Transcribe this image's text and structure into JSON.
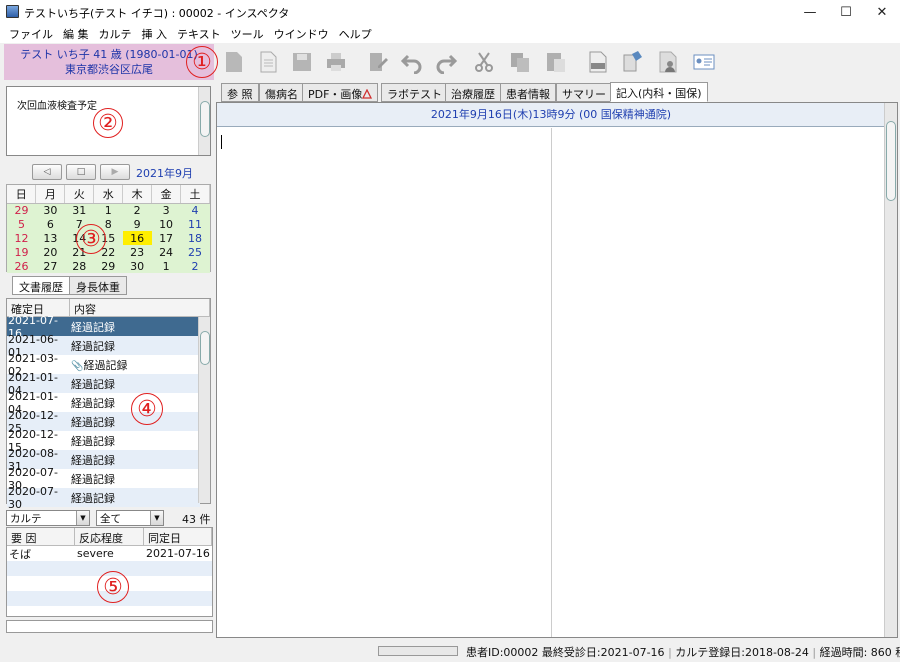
{
  "window": {
    "title": "テストいち子(テスト イチコ) : 00002 - インスペクタ"
  },
  "menu": [
    "ファイル",
    "編 集",
    "カルテ",
    "挿 入",
    "テキスト",
    "ツール",
    "ウインドウ",
    "ヘルプ"
  ],
  "patient": {
    "line1": "テスト いち子  41 歳 (1980-01-01)",
    "line2": "東京都渋谷区広尾"
  },
  "memo": {
    "text": "次回血液検査予定"
  },
  "calendar": {
    "month": "2021年9月",
    "weekdays": [
      "日",
      "月",
      "火",
      "水",
      "木",
      "金",
      "土"
    ],
    "weeks": [
      [
        "29",
        "30",
        "31",
        "1",
        "2",
        "3",
        "4"
      ],
      [
        "5",
        "6",
        "7",
        "8",
        "9",
        "10",
        "11"
      ],
      [
        "12",
        "13",
        "14",
        "15",
        "16",
        "17",
        "18"
      ],
      [
        "19",
        "20",
        "21",
        "22",
        "23",
        "24",
        "25"
      ],
      [
        "26",
        "27",
        "28",
        "29",
        "30",
        "1",
        "2"
      ]
    ],
    "highlight": "16"
  },
  "left_tabs": [
    "文書履歴",
    "身長体重"
  ],
  "doc_table": {
    "headers": [
      "確定日",
      "内容"
    ],
    "rows": [
      {
        "date": "2021-07-16",
        "content": "経過記録"
      },
      {
        "date": "2021-06-01",
        "content": "経過記録"
      },
      {
        "date": "2021-03-02",
        "content": "経過記録",
        "attach": true
      },
      {
        "date": "2021-01-04",
        "content": "経過記録"
      },
      {
        "date": "2021-01-04",
        "content": "経過記録"
      },
      {
        "date": "2020-12-25",
        "content": "経過記録"
      },
      {
        "date": "2020-12-15",
        "content": "経過記録"
      },
      {
        "date": "2020-08-31",
        "content": "経過記録"
      },
      {
        "date": "2020-07-30",
        "content": "経過記録"
      },
      {
        "date": "2020-07-30",
        "content": "経過記録"
      }
    ]
  },
  "filters": {
    "type": "カルテ",
    "period": "全て",
    "count": "43 件"
  },
  "allergy": {
    "headers": [
      "要 因",
      "反応程度",
      "同定日"
    ],
    "rows": [
      {
        "factor": "そば",
        "severity": "severe",
        "date": "2021-07-16"
      }
    ]
  },
  "right_tabs": [
    "参 照",
    "傷病名",
    "PDF・画像",
    "ラボテスト",
    "治療履歴",
    "患者情報",
    "サマリー",
    "記入(内科・国保)"
  ],
  "editor": {
    "header": "2021年9月16日(木)13時9分 (00 国保精神通院)"
  },
  "status": {
    "patient_id": "患者ID:00002",
    "last_visit": "最終受診日:2021-07-16",
    "registered": "カルテ登録日:2018-08-24",
    "elapsed": "経過時間: 860 秒"
  },
  "annotations": [
    "①",
    "②",
    "③",
    "④",
    "⑤"
  ],
  "colors": {
    "patient_bg": "#e5bfdc",
    "selected_row": "#3f6a90",
    "calendar_bg": "#def3d2",
    "highlight": "#ffee00",
    "accent_text": "#1f3fb0",
    "annotation": "#e02020"
  }
}
